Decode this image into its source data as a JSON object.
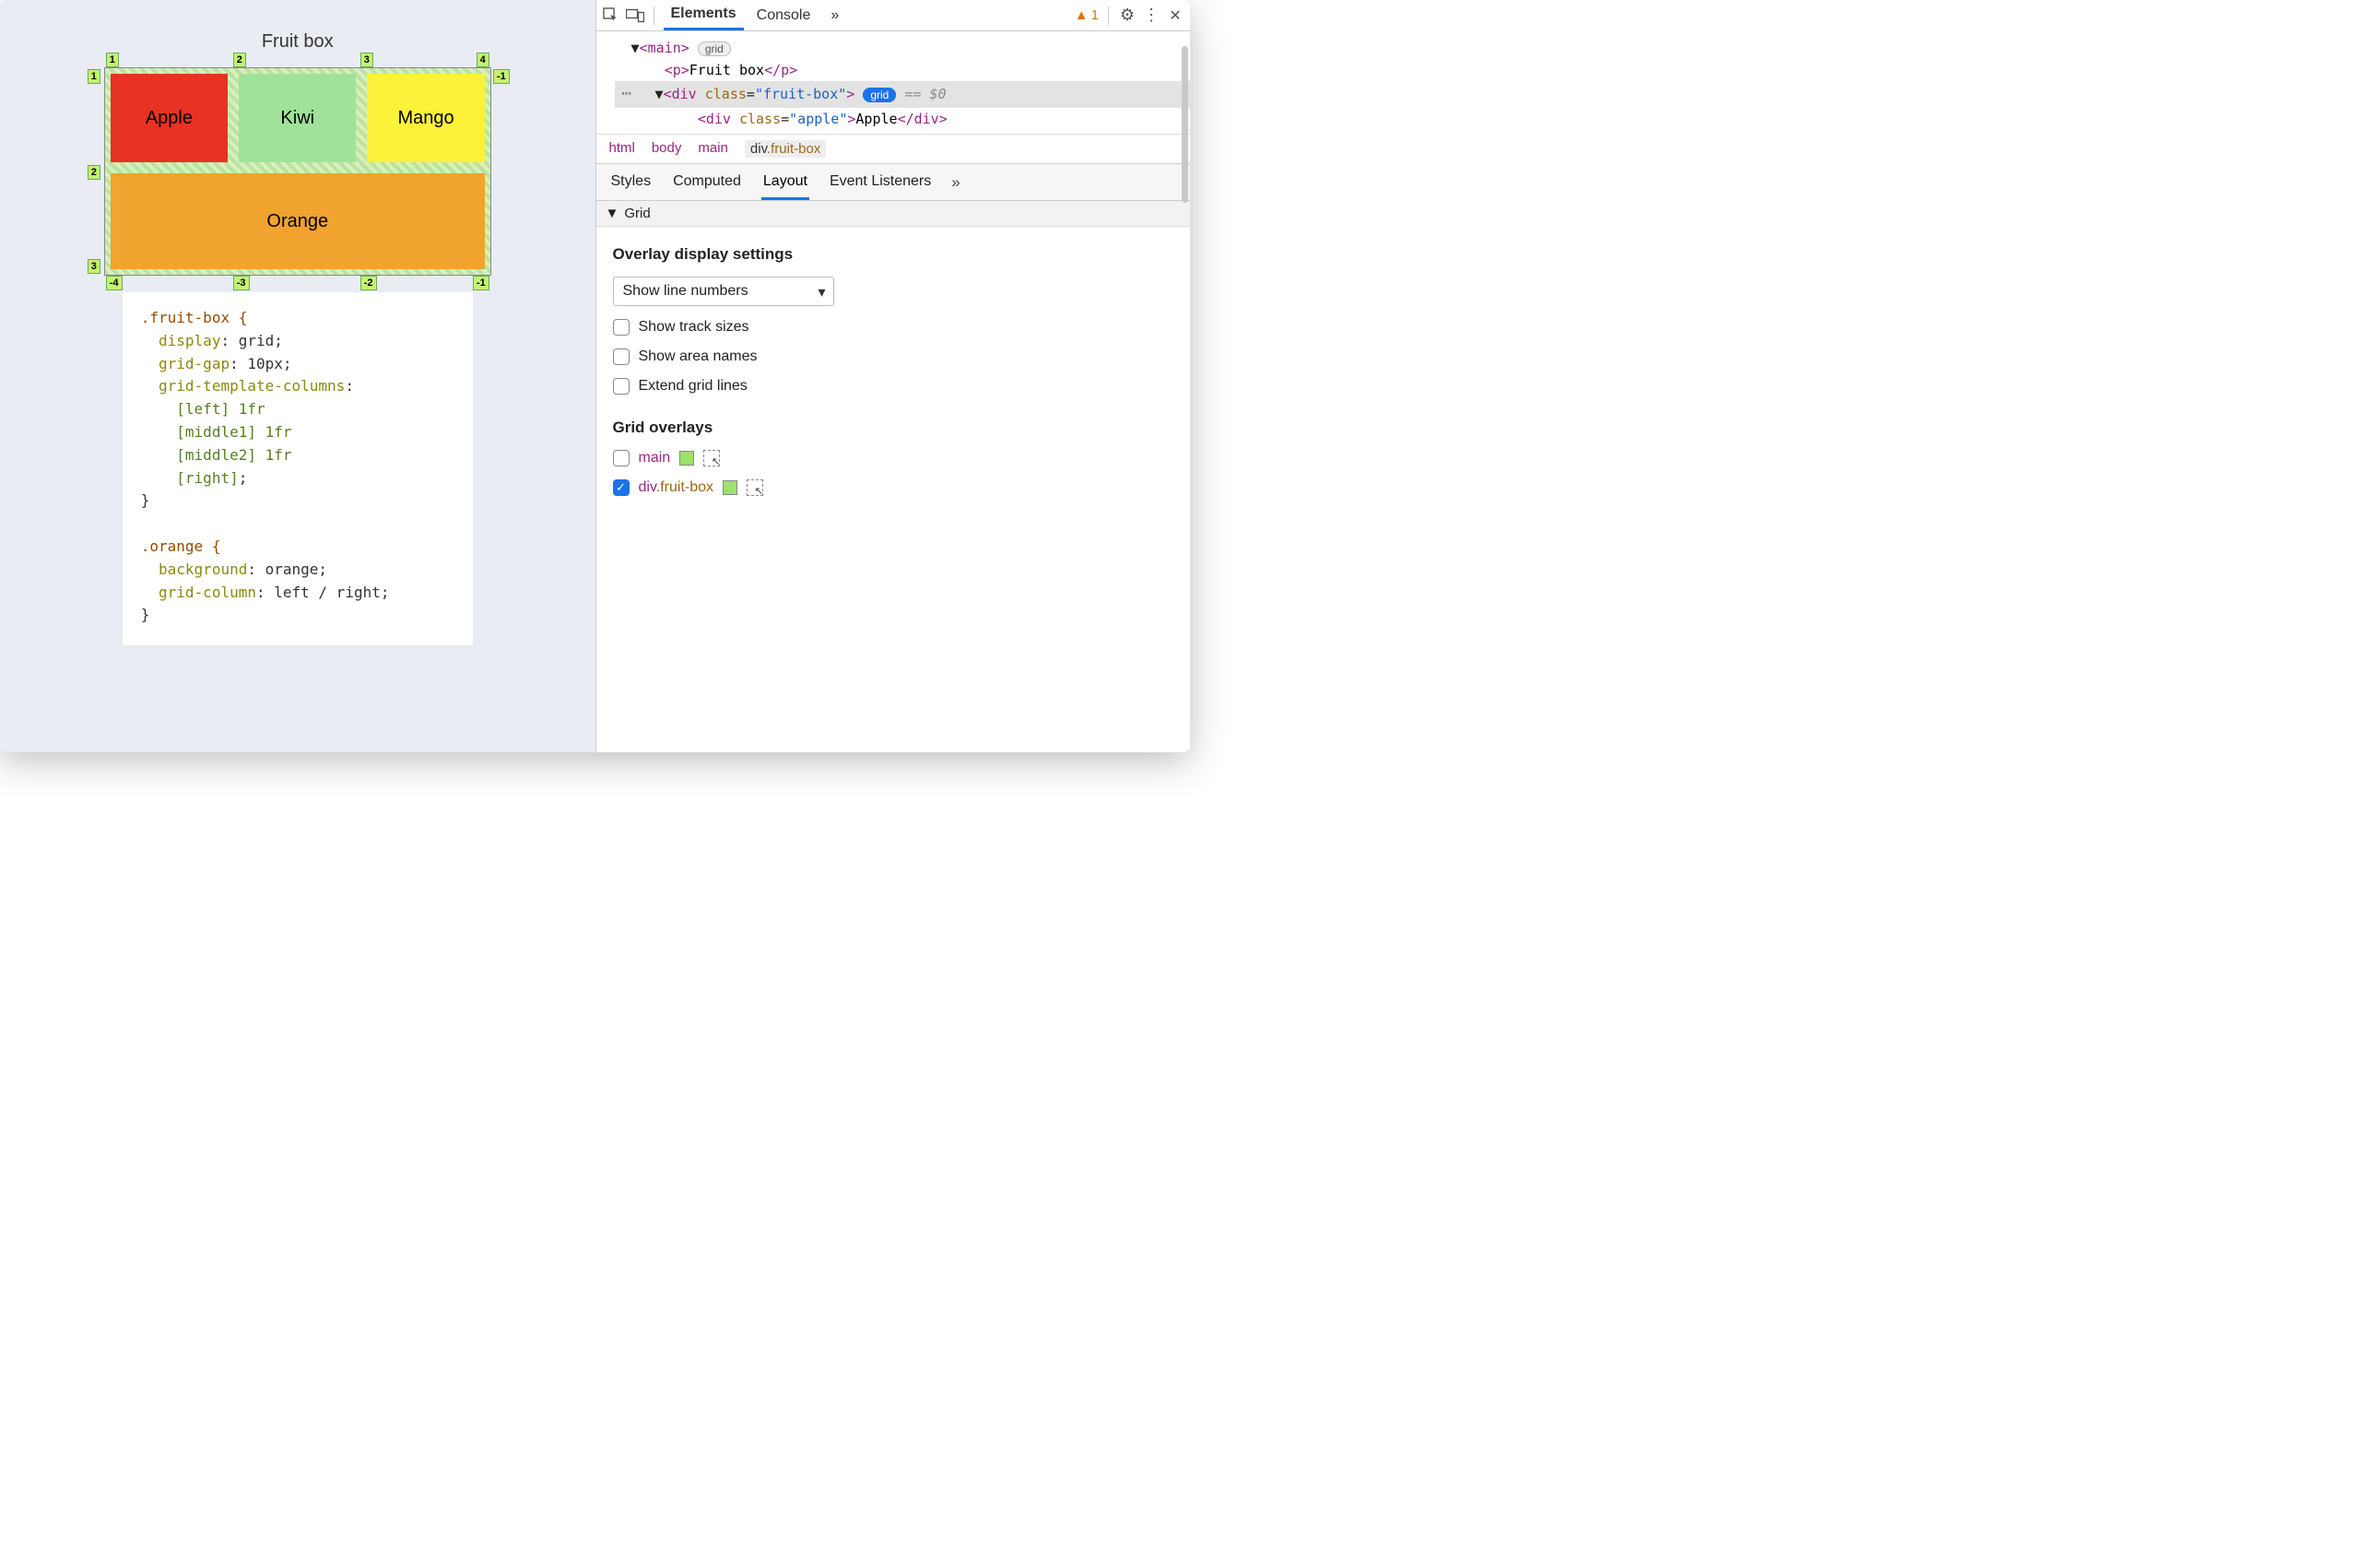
{
  "viewport": {
    "title": "Fruit box",
    "cells": {
      "apple": "Apple",
      "kiwi": "Kiwi",
      "mango": "Mango",
      "orange": "Orange"
    },
    "line_badges": {
      "top": [
        "1",
        "2",
        "3",
        "4"
      ],
      "bottom": [
        "-4",
        "-3",
        "-2",
        "-1"
      ],
      "left": [
        "1",
        "2",
        "3"
      ],
      "right": [
        "-1"
      ]
    },
    "css": {
      "sel1": ".fruit-box {",
      "p1": "display",
      "v1": "grid",
      "p2": "grid-gap",
      "v2": "10px",
      "p3": "grid-template-columns",
      "l1": "[left] 1fr",
      "l2": "[middle1] 1fr",
      "l3": "[middle2] 1fr",
      "l4": "[right]",
      "close1": "}",
      "sel2": ".orange {",
      "p4": "background",
      "v4": "orange",
      "p5": "grid-column",
      "v5": "left / right",
      "close2": "}"
    }
  },
  "devtools": {
    "tabs": {
      "elements": "Elements",
      "console": "Console",
      "more": "»",
      "warn_count": "1"
    },
    "dom": {
      "main_open": "<main>",
      "main_pill": "grid",
      "p_line": "<p>Fruit box</p>",
      "div_open_a": "<div ",
      "div_attr": "class",
      "div_val": "\"fruit-box\"",
      "div_open_b": ">",
      "div_pill": "grid",
      "sel_suffix": " == $0",
      "apple_a": "<div ",
      "apple_attr": "class",
      "apple_val": "\"apple\"",
      "apple_b": ">Apple</div>"
    },
    "crumbs": [
      "html",
      "body",
      "main",
      "div.fruit-box"
    ],
    "subtabs": [
      "Styles",
      "Computed",
      "Layout",
      "Event Listeners",
      "»"
    ],
    "grid_section": "Grid",
    "overlay_settings": {
      "heading": "Overlay display settings",
      "select": "Show line numbers",
      "opts": [
        "Show track sizes",
        "Show area names",
        "Extend grid lines"
      ]
    },
    "grid_overlays": {
      "heading": "Grid overlays",
      "items": [
        {
          "label_tag": "main",
          "label_cls": "",
          "checked": false,
          "swatch": "#9de06b"
        },
        {
          "label_tag": "div",
          "label_cls": ".fruit-box",
          "checked": true,
          "swatch": "#9de06b"
        }
      ]
    }
  }
}
